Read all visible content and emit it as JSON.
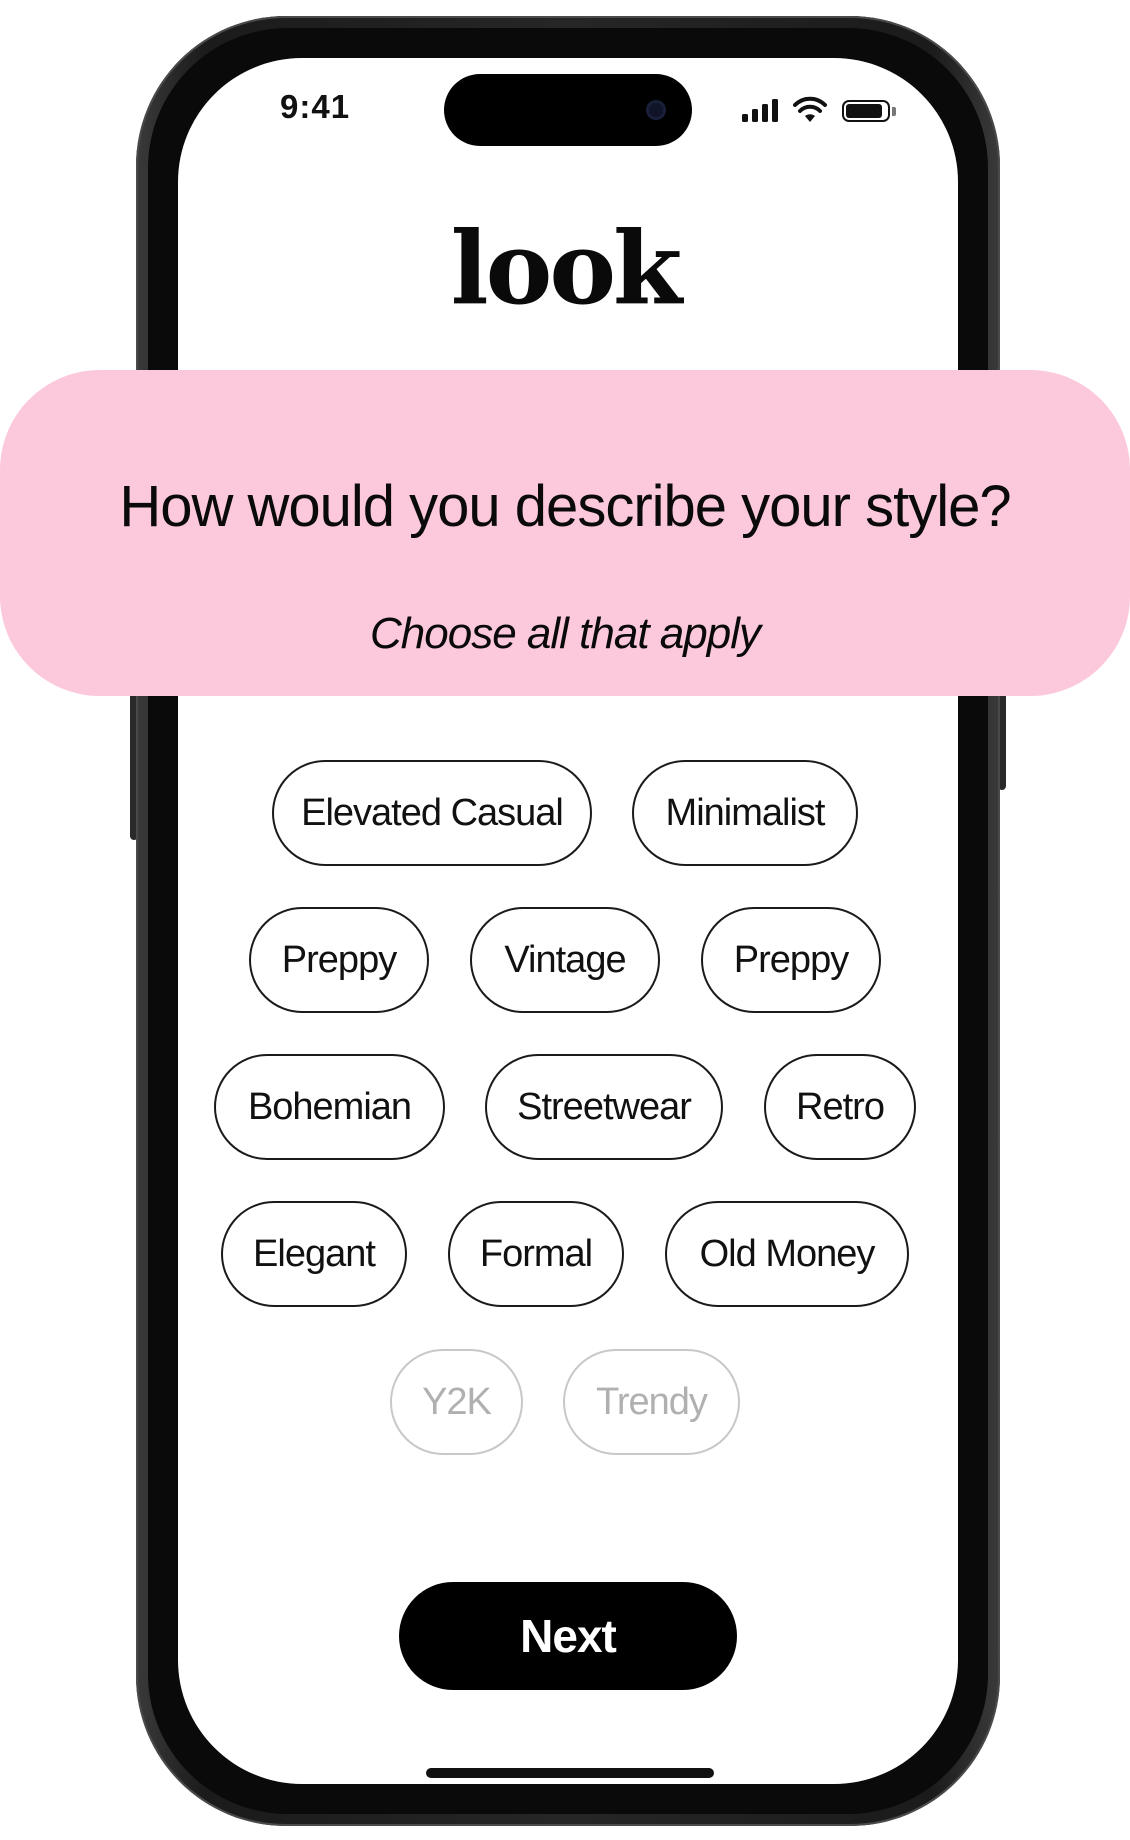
{
  "status_bar": {
    "time": "9:41"
  },
  "app": {
    "logo": "look"
  },
  "question": {
    "title": "How would you describe your style?",
    "subtitle": "Choose all that apply"
  },
  "styles": {
    "options": [
      {
        "label": "Elevated Casual",
        "state": "active"
      },
      {
        "label": "Minimalist",
        "state": "active"
      },
      {
        "label": "Preppy",
        "state": "active"
      },
      {
        "label": "Vintage",
        "state": "active"
      },
      {
        "label": "Preppy",
        "state": "active"
      },
      {
        "label": "Bohemian",
        "state": "active"
      },
      {
        "label": "Streetwear",
        "state": "active"
      },
      {
        "label": "Retro",
        "state": "active"
      },
      {
        "label": "Elegant",
        "state": "active"
      },
      {
        "label": "Formal",
        "state": "active"
      },
      {
        "label": "Old Money",
        "state": "active"
      },
      {
        "label": "Y2K",
        "state": "faded"
      },
      {
        "label": "Trendy",
        "state": "faded"
      }
    ]
  },
  "actions": {
    "next_label": "Next"
  },
  "colors": {
    "banner": "#fcc8dc",
    "button": "#000000",
    "chip_border": "#1a1a1a",
    "chip_faded": "#c8c8c8"
  }
}
